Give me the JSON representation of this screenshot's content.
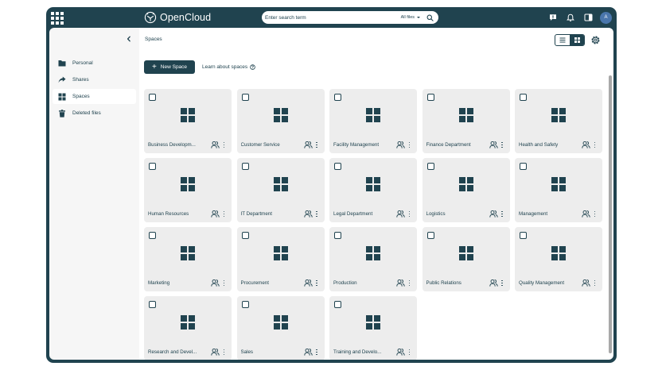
{
  "header": {
    "app_name": "OpenCloud",
    "search": {
      "placeholder": "Enter search term",
      "filter": "All files"
    },
    "avatar_initial": "A"
  },
  "sidebar": {
    "items": [
      {
        "label": "Personal",
        "icon": "folder-icon",
        "active": false
      },
      {
        "label": "Shares",
        "icon": "share-arrow-icon",
        "active": false
      },
      {
        "label": "Spaces",
        "icon": "spaces-grid-icon",
        "active": true
      },
      {
        "label": "Deleted files",
        "icon": "trash-icon",
        "active": false
      }
    ]
  },
  "main": {
    "breadcrumb": "Spaces",
    "new_space_label": "New Space",
    "learn_label": "Learn about spaces",
    "view_mode": "tiles",
    "spaces": [
      {
        "name": "Business Developm..."
      },
      {
        "name": "Customer Service"
      },
      {
        "name": "Facility Management"
      },
      {
        "name": "Finance Department"
      },
      {
        "name": "Health and Safety"
      },
      {
        "name": "Human Resources"
      },
      {
        "name": "IT Department"
      },
      {
        "name": "Legal Department"
      },
      {
        "name": "Logistics"
      },
      {
        "name": "Management"
      },
      {
        "name": "Marketing"
      },
      {
        "name": "Procurement"
      },
      {
        "name": "Production"
      },
      {
        "name": "Public Relations"
      },
      {
        "name": "Quality Management"
      },
      {
        "name": "Research and Devel..."
      },
      {
        "name": "Sales"
      },
      {
        "name": "Training and Develo..."
      }
    ]
  },
  "colors": {
    "primary": "#20434f",
    "card_bg": "#ededed",
    "sidebar_bg": "#f6f6f6",
    "avatar": "#4a76ac"
  }
}
